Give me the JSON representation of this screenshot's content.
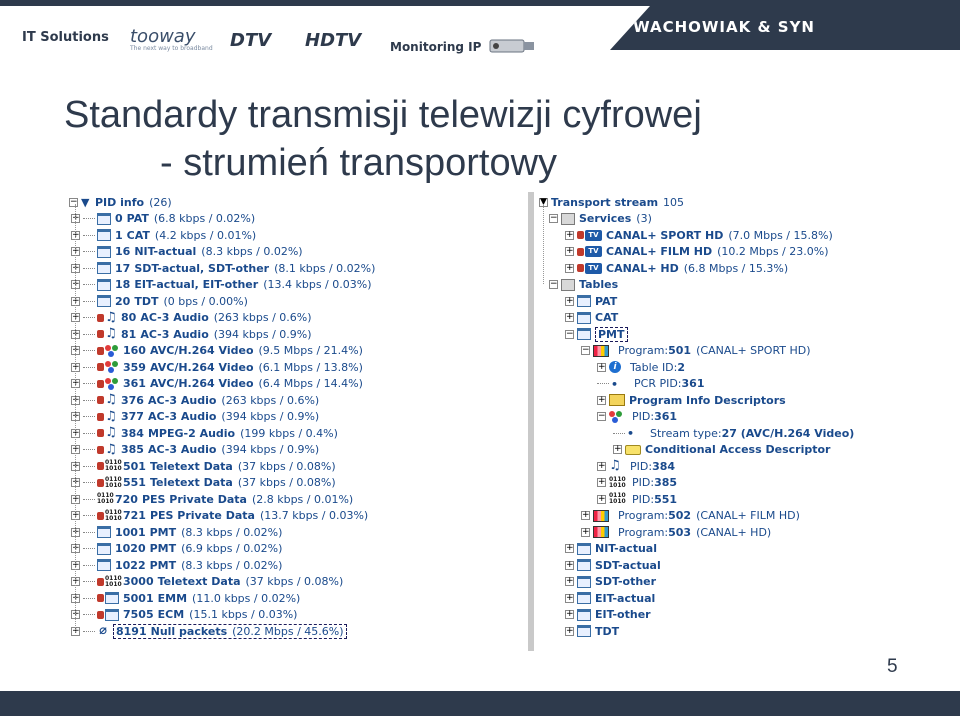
{
  "header": {
    "logos": [
      "IT Solutions",
      "tooway",
      "DTV",
      "HDTV",
      "Monitoring IP"
    ],
    "tooway_tagline": "The next way to broadband",
    "company": "WACHOWIAK & SYN",
    "colors": {
      "band": "#2e3a4c",
      "accent_text": "#1a4a8c",
      "lock": "#c0392b"
    }
  },
  "title": "Standardy transmisji telewizji cyfrowej",
  "subtitle": "- strumień transportowy",
  "page_number": "5",
  "pid_panel": {
    "root_label": "PID info",
    "root_count": "(26)",
    "rows": [
      {
        "pid": "0",
        "name": "PAT",
        "rate": "(6.8 kbps / 0.02%)",
        "icon": "doc-icon",
        "lock": false
      },
      {
        "pid": "1",
        "name": "CAT",
        "rate": "(4.2 kbps / 0.01%)",
        "icon": "doc-icon",
        "lock": false
      },
      {
        "pid": "16",
        "name": "NIT-actual",
        "rate": "(8.3 kbps / 0.02%)",
        "icon": "doc-icon",
        "lock": false
      },
      {
        "pid": "17",
        "name": "SDT-actual, SDT-other",
        "rate": "(8.1 kbps / 0.02%)",
        "icon": "doc-icon",
        "lock": false
      },
      {
        "pid": "18",
        "name": "EIT-actual, EIT-other",
        "rate": "(13.4 kbps / 0.03%)",
        "icon": "doc-icon",
        "lock": false
      },
      {
        "pid": "20",
        "name": "TDT",
        "rate": "(0 bps / 0.00%)",
        "icon": "doc-icon",
        "lock": false
      },
      {
        "pid": "80",
        "name": "AC-3 Audio",
        "rate": "(263 kbps / 0.6%)",
        "icon": "note-icon",
        "lock": true
      },
      {
        "pid": "81",
        "name": "AC-3 Audio",
        "rate": "(394 kbps / 0.9%)",
        "icon": "note-icon",
        "lock": true
      },
      {
        "pid": "160",
        "name": "AVC/H.264 Video",
        "rate": "(9.5 Mbps / 21.4%)",
        "icon": "rgb-icon",
        "lock": true
      },
      {
        "pid": "359",
        "name": "AVC/H.264 Video",
        "rate": "(6.1 Mbps / 13.8%)",
        "icon": "rgb-icon",
        "lock": true
      },
      {
        "pid": "361",
        "name": "AVC/H.264 Video",
        "rate": "(6.4 Mbps / 14.4%)",
        "icon": "rgb-icon",
        "lock": true
      },
      {
        "pid": "376",
        "name": "AC-3 Audio",
        "rate": "(263 kbps / 0.6%)",
        "icon": "note-icon",
        "lock": true
      },
      {
        "pid": "377",
        "name": "AC-3 Audio",
        "rate": "(394 kbps / 0.9%)",
        "icon": "note-icon",
        "lock": true
      },
      {
        "pid": "384",
        "name": "MPEG-2 Audio",
        "rate": "(199 kbps / 0.4%)",
        "icon": "note-icon",
        "lock": true
      },
      {
        "pid": "385",
        "name": "AC-3 Audio",
        "rate": "(394 kbps / 0.9%)",
        "icon": "note-icon",
        "lock": true
      },
      {
        "pid": "501",
        "name": "Teletext Data",
        "rate": "(37 kbps / 0.08%)",
        "icon": "binary-icon",
        "lock": true
      },
      {
        "pid": "551",
        "name": "Teletext Data",
        "rate": "(37 kbps / 0.08%)",
        "icon": "binary-icon",
        "lock": true
      },
      {
        "pid": "720",
        "name": "PES Private Data",
        "rate": "(2.8 kbps / 0.01%)",
        "icon": "binary-icon",
        "lock": false
      },
      {
        "pid": "721",
        "name": "PES Private Data",
        "rate": "(13.7 kbps / 0.03%)",
        "icon": "binary-icon",
        "lock": true
      },
      {
        "pid": "1001",
        "name": "PMT",
        "rate": "(8.3 kbps / 0.02%)",
        "icon": "doc-icon",
        "lock": false
      },
      {
        "pid": "1020",
        "name": "PMT",
        "rate": "(6.9 kbps / 0.02%)",
        "icon": "doc-icon",
        "lock": false
      },
      {
        "pid": "1022",
        "name": "PMT",
        "rate": "(8.3 kbps / 0.02%)",
        "icon": "doc-icon",
        "lock": false
      },
      {
        "pid": "3000",
        "name": "Teletext Data",
        "rate": "(37 kbps / 0.08%)",
        "icon": "binary-icon",
        "lock": true
      },
      {
        "pid": "5001",
        "name": "EMM",
        "rate": "(11.0 kbps / 0.02%)",
        "icon": "doc-icon",
        "lock": true
      },
      {
        "pid": "7505",
        "name": "ECM",
        "rate": "(15.1 kbps / 0.03%)",
        "icon": "doc-icon",
        "lock": true
      },
      {
        "pid": "8191",
        "name": "Null packets",
        "rate": "(20.2 Mbps / 45.6%)",
        "icon": "null-icon",
        "lock": false,
        "selected": true
      }
    ]
  },
  "ts_panel": {
    "root_label": "Transport stream",
    "root_value": "105",
    "services_label": "Services",
    "services_count": "(3)",
    "services": [
      {
        "name": "CANAL+ SPORT HD",
        "rate": "(7.0 Mbps / 15.8%)"
      },
      {
        "name": "CANAL+ FILM HD",
        "rate": "(10.2 Mbps / 23.0%)"
      },
      {
        "name": "CANAL+ HD",
        "rate": "(6.8 Mbps / 15.3%)"
      }
    ],
    "tables_label": "Tables",
    "tables_top": [
      "PAT",
      "CAT",
      "PMT"
    ],
    "program_label": "Program:",
    "programs": [
      {
        "number": "501",
        "name": "(CANAL+ SPORT HD)"
      },
      {
        "number": "502",
        "name": "(CANAL+ FILM HD)"
      },
      {
        "number": "503",
        "name": "(CANAL+ HD)"
      }
    ],
    "program_children": {
      "table_id_label": "Table ID:",
      "table_id": "2",
      "pcr_pid_label": "PCR PID:",
      "pcr_pid": "361",
      "program_info": "Program Info Descriptors",
      "pid_label": "PID:",
      "pid_video": "361",
      "stream_type_label": "Stream type:",
      "stream_type": "27 (AVC/H.264 Video)",
      "cad": "Conditional Access Descriptor",
      "pid_audio1": "384",
      "pid_audio2": "385",
      "pid_teletext": "551"
    },
    "tables_bottom": [
      "NIT-actual",
      "SDT-actual",
      "SDT-other",
      "EIT-actual",
      "EIT-other",
      "TDT"
    ]
  }
}
